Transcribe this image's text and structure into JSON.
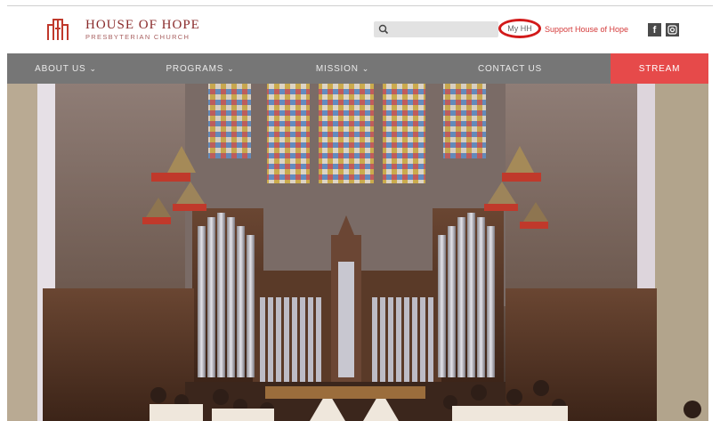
{
  "header": {
    "logo_title": "HOUSE OF HOPE",
    "logo_subtitle": "PRESBYTERIAN CHURCH",
    "search_placeholder": "",
    "my_link": "My HH",
    "support_link": "Support House of Hope",
    "facebook_icon": "facebook-icon",
    "instagram_icon": "instagram-icon",
    "brand_color": "#8a2b2b",
    "accent_color": "#e64a4a"
  },
  "nav": {
    "items": [
      {
        "label": "ABOUT US",
        "dropdown": true
      },
      {
        "label": "PROGRAMS",
        "dropdown": true
      },
      {
        "label": "MISSION",
        "dropdown": true
      },
      {
        "label": "CONTACT US",
        "dropdown": false
      },
      {
        "label": "STREAM",
        "dropdown": false
      }
    ],
    "bar_color": "#767676"
  },
  "hero": {
    "description_icon": "church-sanctuary-photo"
  }
}
